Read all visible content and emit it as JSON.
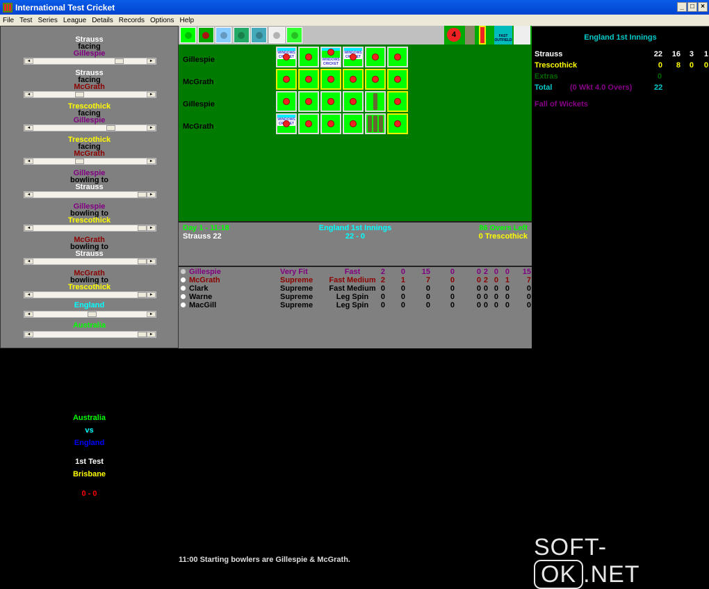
{
  "window": {
    "title": "International Test Cricket"
  },
  "menu": [
    "File",
    "Test",
    "Series",
    "League",
    "Details",
    "Records",
    "Options",
    "Help"
  ],
  "sliders": [
    {
      "top": "Strauss",
      "mid": "facing",
      "bot": "Gillespie",
      "c1": "#ffffff",
      "c3": "#800080",
      "value": 0.78
    },
    {
      "top": "Strauss",
      "mid": "facing",
      "bot": "McGrath",
      "c1": "#ffffff",
      "c3": "#8b0000",
      "value": 0.4
    },
    {
      "top": "Trescothick",
      "mid": "facing",
      "bot": "Gillespie",
      "c1": "#ffff00",
      "c3": "#800080",
      "value": 0.7
    },
    {
      "top": "Trescothick",
      "mid": "facing",
      "bot": "McGrath",
      "c1": "#ffff00",
      "c3": "#8b0000",
      "value": 0.4
    },
    {
      "top": "Gillespie",
      "mid": "bowling to",
      "bot": "Strauss",
      "c1": "#800080",
      "c3": "#ffffff",
      "value": 1.0
    },
    {
      "top": "Gillespie",
      "mid": "bowling to",
      "bot": "Trescothick",
      "c1": "#800080",
      "c3": "#ffff00",
      "value": 1.0
    },
    {
      "top": "McGrath",
      "mid": "bowling to",
      "bot": "Strauss",
      "c1": "#8b0000",
      "c3": "#ffffff",
      "value": 1.0
    },
    {
      "top": "McGrath",
      "mid": "bowling to",
      "bot": "Trescothick",
      "c1": "#8b0000",
      "c3": "#ffff00",
      "value": 1.0
    }
  ],
  "team_sliders": [
    {
      "label": "England",
      "color": "#00ffff",
      "value": 0.52
    },
    {
      "label": "Australia",
      "color": "#00ff00",
      "value": 1.0
    }
  ],
  "toolbar": {
    "icons": [
      "bat-icon",
      "ball-icon",
      "crowd-icon",
      "umpire-icon",
      "pavilion-icon",
      "scoreboard-icon",
      "clock-icon"
    ],
    "boundary_badge": "4",
    "outfield": "FAST OUTFIELD"
  },
  "overs": [
    {
      "bowler": "Gillespie",
      "balls": [
        "ad",
        "ball",
        "adball",
        "ad",
        "ball",
        "ball"
      ],
      "border": [
        "w",
        "w",
        "w",
        "w",
        "w",
        "w"
      ]
    },
    {
      "bowler": "McGrath",
      "balls": [
        "ball",
        "ball",
        "ball",
        "ball",
        "ball",
        "ball"
      ],
      "border": [
        "y",
        "y",
        "y",
        "y",
        "y",
        "y"
      ]
    },
    {
      "bowler": "Gillespie",
      "balls": [
        "ball",
        "ball",
        "ball",
        "ball",
        "bat",
        "ball"
      ],
      "border": [
        "w",
        "w",
        "w",
        "w",
        "w",
        "y"
      ]
    },
    {
      "bowler": "McGrath",
      "balls": [
        "ad",
        "ball",
        "ball",
        "ball",
        "bats3",
        "ball"
      ],
      "border": [
        "w",
        "w",
        "w",
        "w",
        "w",
        "y"
      ]
    }
  ],
  "ad_text": "WINDOWS CRICKET",
  "info": {
    "day": "Day 1 - 11:18",
    "innings": "England 1st Innings",
    "overs_left": "86 Overs Left",
    "batter1": "Strauss  22",
    "score": "22 - 0",
    "batter2": "0  Trescothick"
  },
  "bowlers": [
    {
      "name": "Gillespie",
      "fitness": "Very Fit",
      "type": "Fast",
      "stats": [
        "2",
        "0",
        "15",
        "0",
        "0",
        "0",
        "2",
        "0",
        "15",
        "0"
      ],
      "color": "#800080",
      "selected": true
    },
    {
      "name": "McGrath",
      "fitness": "Supreme",
      "type": "Fast Medium",
      "stats": [
        "2",
        "1",
        "7",
        "0",
        "0",
        "0",
        "2",
        "1",
        "7",
        "0"
      ],
      "color": "#8b0000"
    },
    {
      "name": "Clark",
      "fitness": "Supreme",
      "type": "Fast Medium",
      "stats": [
        "0",
        "0",
        "0",
        "0",
        "0",
        "0",
        "0",
        "0",
        "0",
        "0"
      ],
      "color": "#000000"
    },
    {
      "name": "Warne",
      "fitness": "Supreme",
      "type": "Leg Spin",
      "stats": [
        "0",
        "0",
        "0",
        "0",
        "0",
        "0",
        "0",
        "0",
        "0",
        "0"
      ],
      "color": "#000000"
    },
    {
      "name": "MacGill",
      "fitness": "Supreme",
      "type": "Leg Spin",
      "stats": [
        "0",
        "0",
        "0",
        "0",
        "0",
        "0",
        "0",
        "0",
        "0",
        "0"
      ],
      "color": "#000000"
    }
  ],
  "scorecard": {
    "title": "England 1st Innings",
    "batters": [
      {
        "name": "Strauss",
        "runs": "22",
        "balls": "16",
        "fours": "3",
        "sixes": "1",
        "color": "#ffffff"
      },
      {
        "name": "Trescothick",
        "runs": "0",
        "balls": "8",
        "fours": "0",
        "sixes": "0",
        "color": "#ffff00"
      }
    ],
    "extras_label": "Extras",
    "extras": "0",
    "total_label": "Total",
    "total_detail": "(0 Wkt 4.0 Overs)",
    "total": "22",
    "fow_label": "Fall of Wickets"
  },
  "summary": {
    "team1": "Australia",
    "vs": "vs",
    "team2": "England",
    "test": "1st Test",
    "venue": "Brisbane",
    "series_score": "0 - 0"
  },
  "status": "11:00  Starting bowlers are Gillespie & McGrath.",
  "watermark": {
    "left": "SOFT-",
    "mid": "OK",
    ".right": ".NET",
    "right": ".NET"
  }
}
